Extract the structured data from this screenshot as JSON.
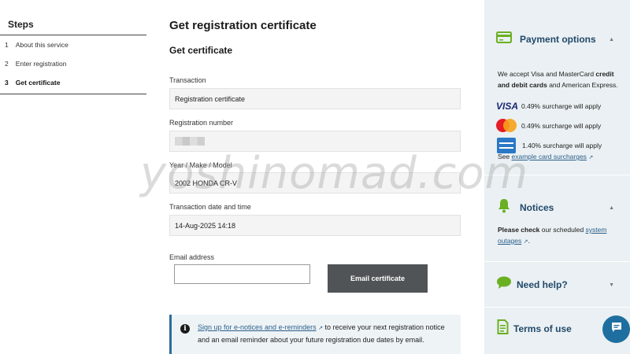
{
  "steps": {
    "title": "Steps",
    "items": [
      {
        "num": "1",
        "label": "About this service"
      },
      {
        "num": "2",
        "label": "Enter registration"
      },
      {
        "num": "3",
        "label": "Get certificate"
      }
    ]
  },
  "main": {
    "page_title": "Get registration certificate",
    "section_title": "Get certificate",
    "fields": {
      "transaction": {
        "label": "Transaction",
        "value": "Registration certificate"
      },
      "registration_number": {
        "label": "Registration number",
        "value": ""
      },
      "vehicle": {
        "label": "Year / Make / Model",
        "value": "2002 HONDA CR-V"
      },
      "datetime": {
        "label": "Transaction date and time",
        "value": "14-Aug-2025 14:18"
      }
    },
    "email": {
      "label": "Email address",
      "value": "",
      "button": "Email certificate"
    },
    "info": {
      "link": "Sign up for e-notices and e-reminders",
      "text": " to receive your next registration notice and an email reminder about your future registration due dates by email."
    }
  },
  "right_panel": {
    "payment": {
      "title": "Payment options",
      "text_pre": "We accept Visa and MasterCard ",
      "text_bold": "credit and debit cards",
      "text_post": " and American Express.",
      "visa_logo": "VISA",
      "visa_surcharge": "0.49% surcharge will apply",
      "mc_surcharge": "0.49% surcharge will apply",
      "amex_surcharge": "1.40% surcharge will apply",
      "see_pre": "See ",
      "see_link": "example card surcharges"
    },
    "notices": {
      "title": "Notices",
      "bold": "Please check",
      "text": " our scheduled ",
      "link": "system outages",
      "end": "."
    },
    "help": {
      "title": "Need help?"
    },
    "terms": {
      "title": "Terms of use"
    }
  },
  "watermark": "yoshinomad.com",
  "colors": {
    "accent": "#22496a",
    "button": "#505456",
    "panel": "#eaf0f3",
    "chat": "#1e6f9f",
    "icon_green": "#6ab023"
  },
  "icons": [
    "credit-card-icon",
    "bell-icon",
    "chat-bubble-icon",
    "document-icon",
    "info-icon",
    "external-link-icon"
  ]
}
